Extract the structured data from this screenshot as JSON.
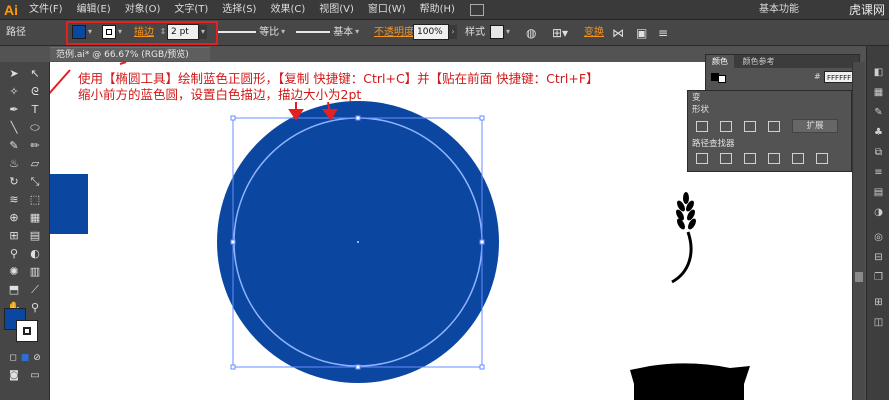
{
  "app": {
    "logo": "Ai",
    "menu": [
      "文件(F)",
      "编辑(E)",
      "对象(O)",
      "文字(T)",
      "选择(S)",
      "效果(C)",
      "视图(V)",
      "窗口(W)",
      "帮助(H)"
    ],
    "workspace": "基本功能",
    "brand": "虎课网"
  },
  "control_bar": {
    "object_type": "路径",
    "fill_color": "#0b47a1",
    "stroke_color": "#ffffff",
    "stroke_label": "描边",
    "stroke_weight": "2 pt",
    "profile_label": "等比",
    "brush_label": "基本",
    "opacity_label": "不透明度",
    "opacity_value": "100%",
    "style_label": "样式",
    "transform_label": "变换"
  },
  "document_tab": "范例.ai* @ 66.67% (RGB/预览)",
  "canvas": {
    "circle_color": "#0b47a1",
    "inner_stroke_color": "#7aa5ff",
    "selection_color": "#6a8cff"
  },
  "annotation": {
    "line1": "使用【椭圆工具】绘制蓝色正圆形，【复制 快捷键：Ctrl+C】并【贴在前面 快捷键：Ctrl+F】",
    "line2": "缩小前方的蓝色圆，设置白色描边，描边大小为2pt",
    "color": "#d01818"
  },
  "color_panel": {
    "tabs": [
      "颜色",
      "颜色参考"
    ],
    "hex": "FFFFFF"
  },
  "pathfinder_panel": {
    "collapsed_tabs": [
      "变",
      "形状"
    ],
    "expand_button": "扩展",
    "title": "路径查找器"
  },
  "toolbox": {
    "fill_color": "#0b47a1",
    "stroke_color": "#ffffff"
  }
}
